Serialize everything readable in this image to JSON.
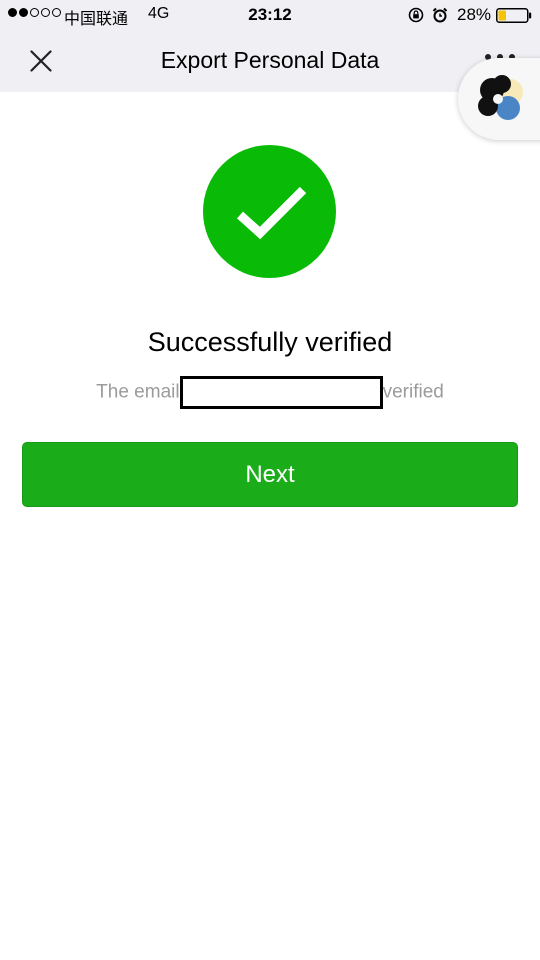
{
  "status_bar": {
    "carrier": "中国联通",
    "network": "4G",
    "time": "23:12",
    "battery_percent": "28%",
    "signal_strength": 2,
    "signal_max": 5,
    "icons": [
      "orientation-lock-icon",
      "alarm-icon",
      "battery-icon"
    ]
  },
  "nav": {
    "title": "Export Personal Data",
    "close_icon": "close-icon",
    "more_icon": "more-icon"
  },
  "floating_bubble": {
    "icon": "mini-program-logo-icon"
  },
  "main": {
    "status_icon": "checkmark-icon",
    "heading": "Successfully verified",
    "subtext_prefix": "The email",
    "subtext_suffix": "verified",
    "next_label": "Next"
  },
  "colors": {
    "success_green": "#09bb07",
    "button_green": "#1aad19",
    "bar_background": "#efeff4",
    "muted_text": "#9b9b9b",
    "battery_fill": "#f5c400"
  }
}
